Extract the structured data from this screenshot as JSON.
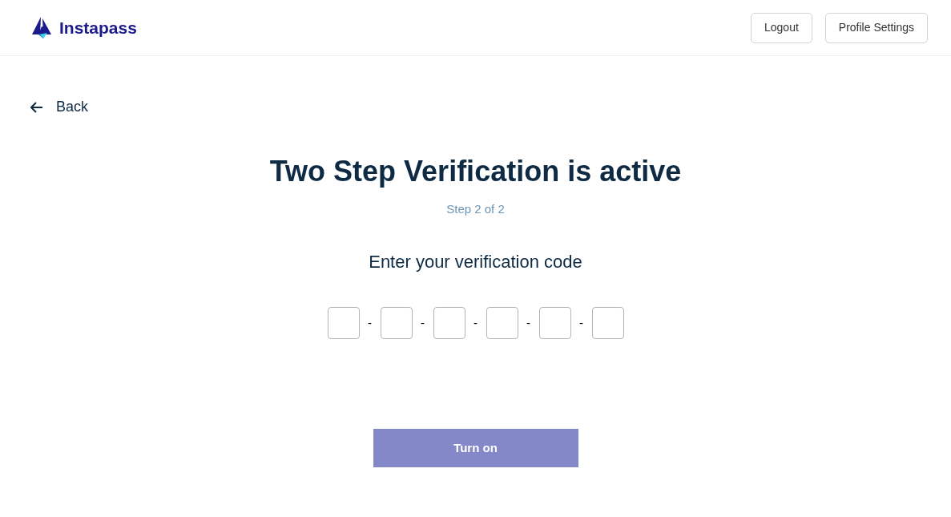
{
  "header": {
    "logo_text": "Instapass",
    "buttons": [
      "Logout",
      "Profile Settings"
    ]
  },
  "back_link": "Back",
  "title": "Two Step Verification is active",
  "step": "Step 2 of 2",
  "prompt": "Enter your verification code",
  "code_fields": [
    {
      "kind": "digit"
    },
    {
      "kind": "digit"
    },
    {
      "kind": "digit"
    },
    {
      "kind": "digit"
    },
    {
      "kind": "digit"
    },
    {
      "kind": "digit"
    }
  ],
  "separators": [
    "-",
    "-",
    "-",
    "-",
    "-"
  ],
  "submit": {
    "label": "Turn on",
    "disabled": true
  }
}
